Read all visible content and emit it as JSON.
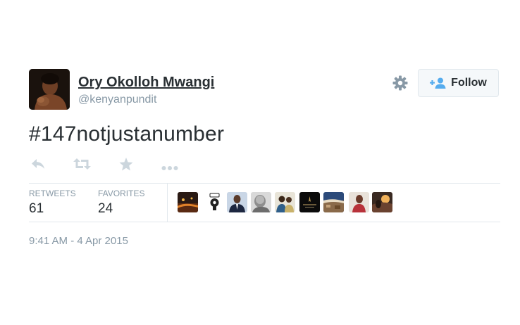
{
  "author": {
    "name": "Ory Okolloh Mwangi",
    "handle": "@kenyanpundit",
    "avatar_icon": "profile-photo-woman-with-baby"
  },
  "header": {
    "settings_icon": "gear-icon",
    "follow_label": "Follow",
    "follow_icon": "add-user-icon"
  },
  "tweet": {
    "text": "#147notjustanumber",
    "timestamp": "9:41 AM - 4 Apr 2015"
  },
  "actions": [
    {
      "name": "reply",
      "icon": "reply-icon"
    },
    {
      "name": "retweet",
      "icon": "retweet-icon"
    },
    {
      "name": "favorite",
      "icon": "star-icon"
    },
    {
      "name": "more",
      "icon": "more-dots-icon"
    }
  ],
  "stats": {
    "retweets_label": "RETWEETS",
    "retweets_count": "61",
    "favorites_label": "FAVORITES",
    "favorites_count": "24"
  },
  "favoriters_count_shown": 9,
  "colors": {
    "text": "#292f33",
    "muted": "#8899a6",
    "icon": "#ccd6dd",
    "border": "#e1e8ed",
    "follow_bg": "#f5f8fa",
    "follow_icon": "#55acee"
  }
}
